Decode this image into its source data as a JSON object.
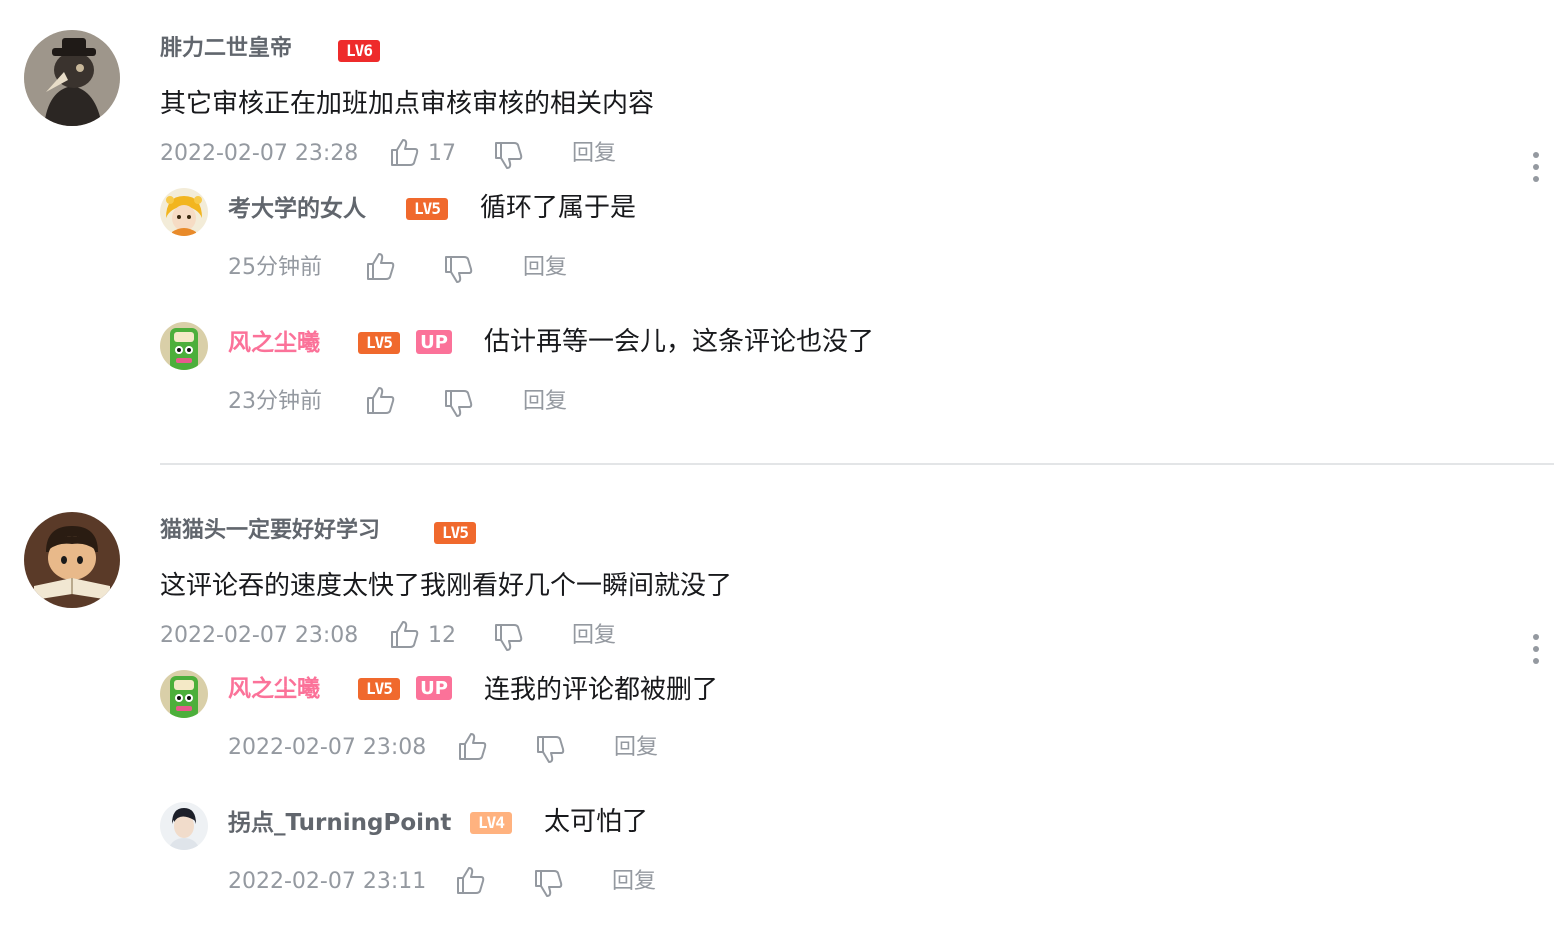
{
  "comments": [
    {
      "user": {
        "name": "腓力二世皇帝",
        "level_label": "LV6",
        "avatar_icon": "avatar-plague-doctor"
      },
      "content": "其它审核正在加班加点审核审核的相关内容",
      "time": "2022-02-07 23:28",
      "likes": "17",
      "reply_label": "回复",
      "replies": [
        {
          "user": {
            "name": "考大学的女人",
            "level_label": "LV5",
            "avatar_icon": "avatar-anime-girl"
          },
          "content": "循环了属于是",
          "time": "25分钟前",
          "reply_label": "回复"
        },
        {
          "user": {
            "name": "风之尘曦",
            "level_label": "LV5",
            "badge": "UP",
            "avatar_icon": "avatar-green-frog"
          },
          "content": "估计再等一会儿，这条评论也没了",
          "time": "23分钟前",
          "reply_label": "回复"
        }
      ]
    },
    {
      "user": {
        "name": "猫猫头一定要好好学习",
        "level_label": "LV5",
        "avatar_icon": "avatar-reading-boy"
      },
      "content": "这评论吞的速度太快了我刚看好几个一瞬间就没了",
      "time": "2022-02-07 23:08",
      "likes": "12",
      "reply_label": "回复",
      "replies": [
        {
          "user": {
            "name": "风之尘曦",
            "level_label": "LV5",
            "badge": "UP",
            "avatar_icon": "avatar-green-frog"
          },
          "content": "连我的评论都被删了",
          "time": "2022-02-07 23:08",
          "reply_label": "回复"
        },
        {
          "user": {
            "name": "拐点_TurningPoint",
            "level_label": "LV4",
            "avatar_icon": "avatar-portrait"
          },
          "content": "太可怕了",
          "time": "2022-02-07 23:11",
          "reply_label": "回复"
        }
      ]
    }
  ],
  "colors": {
    "username": "#61666d",
    "up_username": "#fb7299",
    "meta": "#9499a0",
    "lv6": "#ee2b2b",
    "lv5": "#f0692d",
    "lv4": "#ffb27f",
    "divider": "#e3e5e7"
  }
}
